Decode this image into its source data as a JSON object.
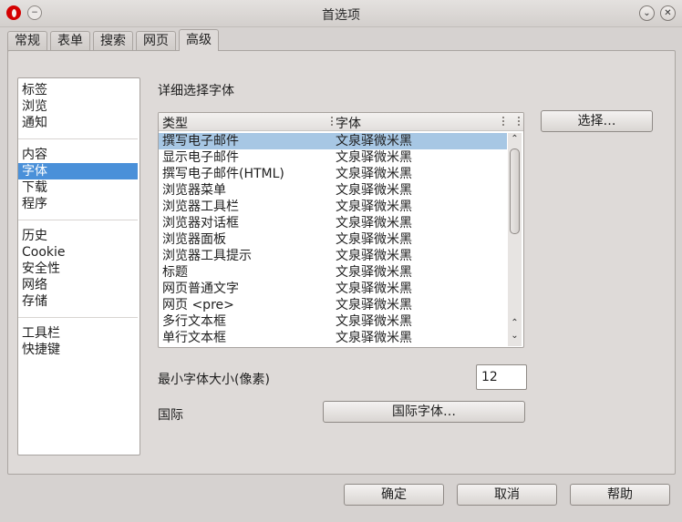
{
  "window": {
    "title": "首选项",
    "minimize_glyph": "⌄",
    "close_glyph": "✕",
    "restore_glyph": "−"
  },
  "tabs": [
    {
      "label": "常规"
    },
    {
      "label": "表单"
    },
    {
      "label": "搜索"
    },
    {
      "label": "网页"
    },
    {
      "label": "高级",
      "active": true
    }
  ],
  "sidebar": {
    "groups": [
      [
        "标签",
        "浏览",
        "通知"
      ],
      [
        "内容",
        "字体",
        "下载",
        "程序"
      ],
      [
        "历史",
        "Cookie",
        "安全性",
        "网络",
        "存储"
      ],
      [
        "工具栏",
        "快捷键"
      ]
    ],
    "selected": "字体"
  },
  "fonts": {
    "section_title": "详细选择字体",
    "col_type": "类型",
    "col_font": "字体",
    "rows": [
      {
        "type": "撰写电子邮件",
        "font": "文泉驿微米黑"
      },
      {
        "type": "显示电子邮件",
        "font": "文泉驿微米黑"
      },
      {
        "type": "撰写电子邮件(HTML)",
        "font": "文泉驿微米黑"
      },
      {
        "type": "浏览器菜单",
        "font": "文泉驿微米黑"
      },
      {
        "type": "浏览器工具栏",
        "font": "文泉驿微米黑"
      },
      {
        "type": "浏览器对话框",
        "font": "文泉驿微米黑"
      },
      {
        "type": "浏览器面板",
        "font": "文泉驿微米黑"
      },
      {
        "type": "浏览器工具提示",
        "font": "文泉驿微米黑"
      },
      {
        "type": "标题",
        "font": "文泉驿微米黑"
      },
      {
        "type": "网页普通文字",
        "font": "文泉驿微米黑"
      },
      {
        "type": "网页 <pre>",
        "font": "文泉驿微米黑"
      },
      {
        "type": "多行文本框",
        "font": "文泉驿微米黑"
      },
      {
        "type": "单行文本框",
        "font": "文泉驿微米黑"
      }
    ],
    "selected_index": 0,
    "choose_button": "选择…",
    "min_size_label": "最小字体大小(像素)",
    "min_size_value": "12",
    "intl_label": "国际",
    "intl_button": "国际字体…"
  },
  "footer": {
    "ok": "确定",
    "cancel": "取消",
    "help": "帮助"
  },
  "colors": {
    "selection_blue": "#4a90d9",
    "row_highlight": "#a7c7e4",
    "opera_red": "#d40000"
  }
}
